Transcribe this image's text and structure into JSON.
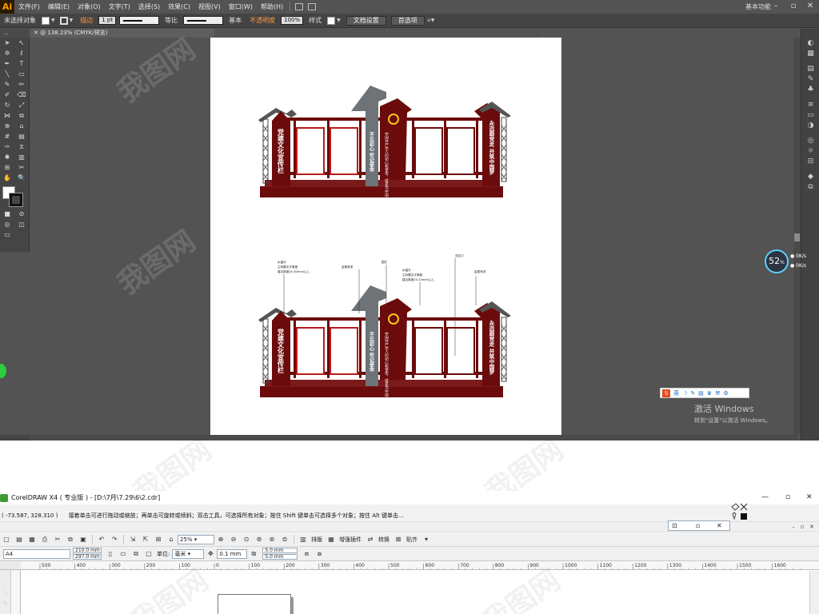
{
  "illustrator": {
    "menu": [
      "文件(F)",
      "编辑(E)",
      "对象(O)",
      "文字(T)",
      "选择(S)",
      "效果(C)",
      "视图(V)",
      "窗口(W)",
      "帮助(H)"
    ],
    "workspace": "基本功能",
    "control": {
      "no_selection": "未选择对象",
      "stroke_label": "描边",
      "stroke_weight": "1 pt",
      "profile": "等比",
      "brush": "基本",
      "opacity_label": "不透明度",
      "opacity_value": "100%",
      "style_label": "样式",
      "doc_setup": "文档设置",
      "preferences": "首选项"
    },
    "tab": "@ 138.23% (CMYK/预览)"
  },
  "design_top": {
    "left_slogan": "党建文化宣传栏",
    "center_slogan": "不忘初心 牢记使命",
    "right_slogan": "永远跟党走 共筑中国梦",
    "center_text": "中国共产党人的初心和使命，就是为中国人民谋幸福，为中华民族谋复兴"
  },
  "design_bottom": {
    "left_slogan": "党建文化宣传栏",
    "center_slogan": "不忘初心 牢记使命",
    "right_slogan": "永远跟党走 共筑中国梦",
    "annotations": {
      "a1_title": "水晶字",
      "a1_line1": "主标题文字厚度",
      "a1_line2": "建议厚度20-30mm以上。",
      "a2": "金属喷漆",
      "a3": "围栏",
      "a4_title": "水晶字",
      "a4_line1": "主标题文字厚度",
      "a4_line2": "建议厚度10-20mm以上。",
      "a5": "亚克力",
      "a6": "金属喷漆"
    }
  },
  "overlay": {
    "speed_value": "52",
    "speed_unit": "%",
    "speed_up": "0K/s",
    "speed_down": "0K/s",
    "ime_items": [
      "英",
      "☽",
      "✎",
      "▤",
      "♛",
      "⚒",
      "⚙"
    ],
    "activate_title": "激活 Windows",
    "activate_sub": "转到\"设置\"以激活 Windows。",
    "watermark": "我图网"
  },
  "coreldraw": {
    "title": "CorelDRAW X4 ( 专业版 ) - [D:\\7月\\7.29\\6\\2.cdr]",
    "coords": "( -73.587, 328.310 )",
    "status_hint": "接着单击可进行拖动或缩放；再单击可旋转或倾斜；双击工具，可选择所有对象；按住 Shift 键单击可选择多个对象；按住 Alt 键单击...",
    "zoom": "25%",
    "toolbar_labels": {
      "layout": "排版",
      "plugins": "增强插件",
      "convert": "转换",
      "paste": "贴齐"
    },
    "page_size": "A4",
    "width": "210.0 mm",
    "height": "297.0 mm",
    "units_label": "单位:",
    "units": "毫米",
    "nudge": "0.1 mm",
    "dup_x": "5.0 mm",
    "dup_y": "5.0 mm",
    "ruler_ticks": [
      "500",
      "400",
      "300",
      "200",
      "100",
      "0",
      "100",
      "200",
      "300",
      "400",
      "500",
      "600",
      "700",
      "800",
      "900",
      "1000",
      "1100",
      "1200",
      "1300",
      "1400",
      "1500",
      "1600"
    ]
  }
}
